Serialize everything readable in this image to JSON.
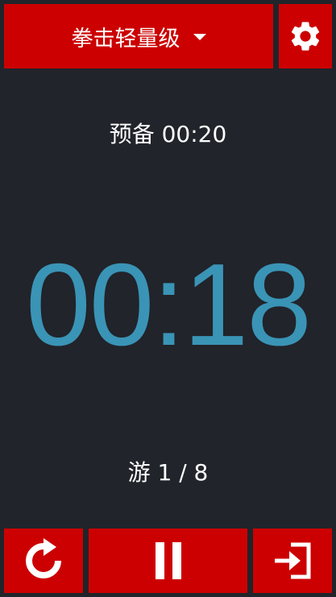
{
  "header": {
    "preset_label": "拳击轻量级",
    "preset_dropdown_icon": "caret-down-icon",
    "settings_icon": "gear-icon"
  },
  "timer": {
    "phase_label": "预备 00:20",
    "time": "00:18",
    "round_label": "游 1 / 8"
  },
  "controls": {
    "reset_icon": "restart-icon",
    "pause_icon": "pause-icon",
    "exit_icon": "exit-icon"
  },
  "colors": {
    "accent": "#cc0000",
    "background": "#21242a",
    "timer": "#3a94b6",
    "text": "#ffffff"
  }
}
